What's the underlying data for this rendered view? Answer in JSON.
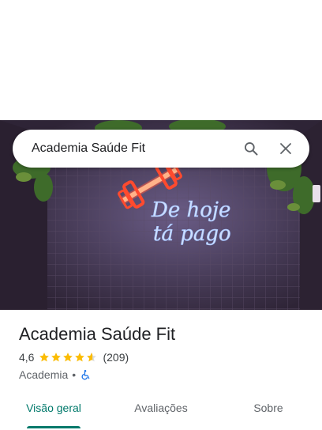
{
  "search": {
    "query": "Academia Saúde Fit"
  },
  "hero": {
    "neon_text_line1": "De hoje",
    "neon_text_line2": "tá pago"
  },
  "place": {
    "name": "Academia Saúde Fit",
    "rating": "4,6",
    "stars": 4.6,
    "review_count": "(209)",
    "category": "Academia",
    "separator": "•",
    "accessibility_icon": "wheelchair-icon"
  },
  "tabs": [
    {
      "label": "Visão geral",
      "active": true
    },
    {
      "label": "Avaliações",
      "active": false
    },
    {
      "label": "Sobre",
      "active": false
    }
  ],
  "colors": {
    "accent": "#00796b",
    "star": "#fbbc04",
    "accessible": "#1a73e8"
  }
}
